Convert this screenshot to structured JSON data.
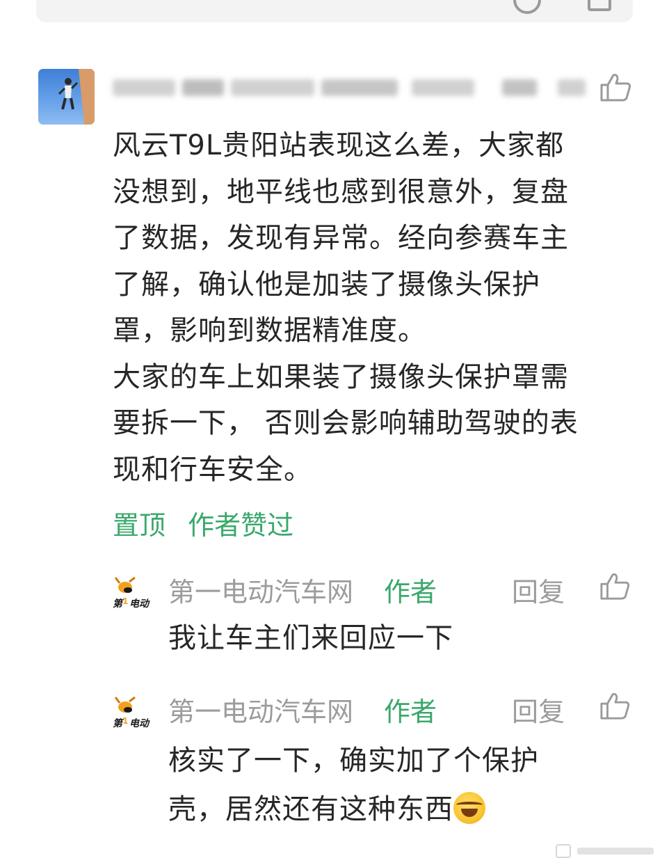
{
  "comment": {
    "lines": [
      "风云T9L贵阳站表现这么差，大家都",
      "没想到，地平线也感到很意外，复盘",
      "了数据，发现有异常。经向参赛车主",
      "了解，确认他是加装了摄像头保护",
      "罩，影响到数据精准度。",
      "大家的车上如果装了摄像头保护罩需",
      "要拆一下， 否则会影响辅助驾驶的表",
      "现和行车安全。"
    ],
    "tags": [
      "置顶",
      "作者赞过"
    ]
  },
  "replies": [
    {
      "name": "第一电动汽车网",
      "author_badge": "作者",
      "reply_label": "回复",
      "text_lines": [
        "我让车主们来回应一下"
      ]
    },
    {
      "name": "第一电动汽车网",
      "author_badge": "作者",
      "reply_label": "回复",
      "text_lines": [
        "核实了一下，确实加了个保护",
        "壳，居然还有这种东西"
      ]
    }
  ],
  "icons": {
    "like": "thumbs-up-icon",
    "emoji": "laughing-crying-emoji"
  },
  "colors": {
    "accent_green": "#3aa86b",
    "muted_gray": "#9c9c9c",
    "text": "#262626"
  }
}
